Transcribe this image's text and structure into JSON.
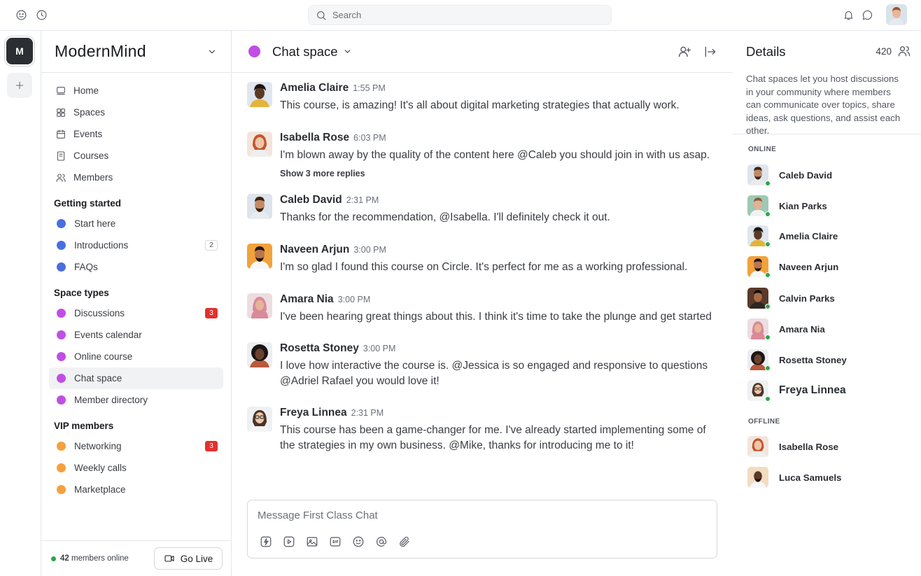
{
  "topbar": {
    "search_placeholder": "Search"
  },
  "rail": {
    "community_initial": "M"
  },
  "sidebar": {
    "brand": "ModernMind",
    "nav": [
      {
        "label": "Home",
        "icon": "home-icon"
      },
      {
        "label": "Spaces",
        "icon": "grid-icon"
      },
      {
        "label": "Events",
        "icon": "calendar-icon"
      },
      {
        "label": "Courses",
        "icon": "book-icon"
      },
      {
        "label": "Members",
        "icon": "members-icon"
      }
    ],
    "sections": [
      {
        "title": "Getting started",
        "items": [
          {
            "label": "Start here",
            "color": "#4a6ee0"
          },
          {
            "label": "Introductions",
            "color": "#4a6ee0",
            "badge": "2"
          },
          {
            "label": "FAQs",
            "color": "#4a6ee0"
          }
        ]
      },
      {
        "title": "Space types",
        "items": [
          {
            "label": "Discussions",
            "color": "#c14ee4",
            "badge": "3"
          },
          {
            "label": "Events calendar",
            "color": "#c14ee4"
          },
          {
            "label": "Online course",
            "color": "#c14ee4"
          },
          {
            "label": "Chat space",
            "color": "#c14ee4",
            "active": true
          },
          {
            "label": "Member directory",
            "color": "#c14ee4"
          }
        ]
      },
      {
        "title": "VIP members",
        "items": [
          {
            "label": "Networking",
            "color": "#f5a03d",
            "badge": "3"
          },
          {
            "label": "Weekly calls",
            "color": "#f5a03d"
          },
          {
            "label": "Marketplace",
            "color": "#f5a03d"
          }
        ]
      }
    ],
    "footer": {
      "online_count": "42",
      "online_label": "members online",
      "go_live": "Go Live"
    }
  },
  "main": {
    "title": "Chat space",
    "messages": [
      {
        "name": "Amelia Claire",
        "time": "1:55 PM",
        "text": "This course, is amazing! It's all about digital marketing strategies that actually work."
      },
      {
        "name": "Isabella Rose",
        "time": "6:03 PM",
        "text": "I'm blown away by the quality of the content here @Caleb you should join in with us asap."
      },
      {
        "name": "Caleb David",
        "time": "2:31 PM",
        "text": "Thanks for the recommendation, @Isabella. I'll definitely check it out."
      },
      {
        "name": "Naveen Arjun",
        "time": "3:00 PM",
        "text": "I'm so glad I found this course on Circle. It's perfect for me as a working professional."
      },
      {
        "name": "Amara Nia",
        "time": "3:00 PM",
        "text": "I've been hearing great things about this. I think it's time to take the plunge and get started"
      },
      {
        "name": "Rosetta Stoney",
        "time": "3:00 PM",
        "text": "I love how interactive the course is. @Jessica is so engaged and responsive to questions @Adriel Rafael you would love it!"
      },
      {
        "name": "Freya Linnea",
        "time": "2:31 PM",
        "text": "This course has been a game-changer for me. I've already started implementing some of the strategies in my own business. @Mike, thanks for introducing me to it!"
      }
    ],
    "show_more_replies": "Show 3 more replies",
    "composer_placeholder": "Message First Class Chat"
  },
  "details": {
    "title": "Details",
    "member_count": "420",
    "description": "Chat spaces let you host discussions in your community where members can communicate over topics, share ideas, ask questions, and assist each other.",
    "online_label": "ONLINE",
    "offline_label": "OFFLINE",
    "online_members": [
      "Caleb David",
      "Kian Parks",
      "Amelia Claire",
      "Naveen Arjun",
      "Calvin Parks",
      "Amara Nia",
      "Rosetta Stoney",
      "Freya Linnea"
    ],
    "offline_members": [
      "Isabella Rose",
      "Luca Samuels"
    ]
  }
}
